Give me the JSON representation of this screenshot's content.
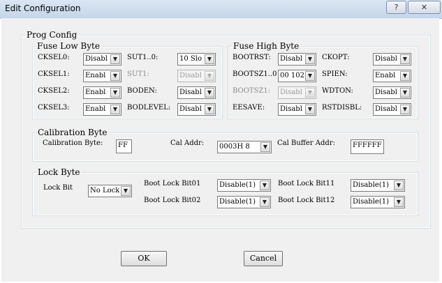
{
  "window": {
    "title": "Edit Configuration",
    "help_glyph": "?",
    "close_glyph": "✕"
  },
  "prog_config": {
    "title": "Prog Config",
    "fuse_low": {
      "title": "Fuse Low Byte",
      "cksel0": {
        "label": "CKSEL0:",
        "value": "Disabl"
      },
      "cksel1": {
        "label": "CKSEL1:",
        "value": "Enabl"
      },
      "cksel2": {
        "label": "CKSEL2:",
        "value": "Enabl"
      },
      "cksel3": {
        "label": "CKSEL3:",
        "value": "Enabl"
      },
      "sut10": {
        "label": "SUT1..0:",
        "value": "10 Slo"
      },
      "sut1": {
        "label": "SUT1:",
        "value": "Disabl"
      },
      "boden": {
        "label": "BODEN:",
        "value": "Disabl"
      },
      "bodlevel": {
        "label": "BODLEVEL:",
        "value": "Disabl"
      }
    },
    "fuse_high": {
      "title": "Fuse High Byte",
      "bootrst": {
        "label": "BOOTRST:",
        "value": "Disabl"
      },
      "bootsz10": {
        "label": "BOOTSZ1..0",
        "value": "00 102"
      },
      "bootsz1": {
        "label": "BOOTSZ1:",
        "value": "Disabl"
      },
      "eesave": {
        "label": "EESAVE:",
        "value": "Disabl"
      },
      "ckopt": {
        "label": "CKOPT:",
        "value": "Disabl"
      },
      "spien": {
        "label": "SPIEN:",
        "value": "Enabl"
      },
      "wdton": {
        "label": "WDTON:",
        "value": "Disabl"
      },
      "rstdisbl": {
        "label": "RSTDISBL:",
        "value": "Disabl"
      }
    },
    "calibration": {
      "title": "Calibration Byte",
      "byte_label": "Calibration Byte:",
      "byte_value": "FF",
      "addr_label": "Cal Addr:",
      "addr_value": "0003H  8",
      "buffer_label": "Cal Buffer Addr:",
      "buffer_value": "FFFFFF"
    },
    "lock": {
      "title": "Lock Byte",
      "lock_bit_label": "Lock Bit",
      "lock_bit_value": "No Lock",
      "blb01_label": "Boot Lock Bit01",
      "blb01_value": "Disable(1)",
      "blb02_label": "Boot Lock Bit02",
      "blb02_value": "Disable(1)",
      "blb11_label": "Boot Lock Bit11",
      "blb11_value": "Disable(1)",
      "blb12_label": "Boot Lock Bit12",
      "blb12_value": "Disable(1)"
    }
  },
  "buttons": {
    "ok": "OK",
    "cancel": "Cancel"
  },
  "icons": {
    "dropdown": "▼"
  }
}
